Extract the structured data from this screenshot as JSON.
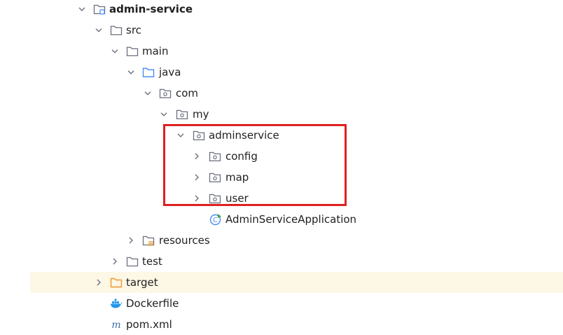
{
  "tree": {
    "admin_service": "admin-service",
    "src": "src",
    "main": "main",
    "java": "java",
    "com": "com",
    "my": "my",
    "adminservice": "adminservice",
    "config": "config",
    "map": "map",
    "user": "user",
    "app_class": "AdminServiceApplication",
    "resources": "resources",
    "test": "test",
    "target": "target",
    "dockerfile": "Dockerfile",
    "pom": "pom.xml"
  },
  "colors": {
    "selection_bg": "#fdf7e6",
    "highlight_border": "#e02020",
    "source_folder": "#4c8bf5",
    "target_folder": "#f0962c",
    "docker": "#2496ed",
    "maven": "#3a6ea5"
  }
}
